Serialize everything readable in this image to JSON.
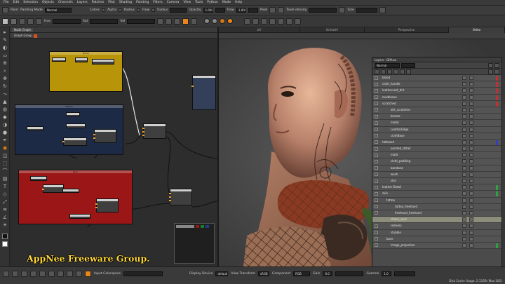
{
  "menu": [
    "File",
    "Edit",
    "Selection",
    "Objects",
    "Channels",
    "Layers",
    "Patches",
    "Pilot",
    "Shading",
    "Painting",
    "Filters",
    "Camera",
    "View",
    "Tools",
    "Python",
    "Mode",
    "Help"
  ],
  "toolbar1": {
    "paint_label": "Paint",
    "painting_mode_label": "Painting Mode",
    "painting_mode_value": "Normal",
    "colors_label": "Colors",
    "alpha_label": "Alpha",
    "radius_label": "Radius",
    "flow_label": "Flow",
    "opacity_label": "Opacity",
    "opacity_value": "1.000",
    "flow2_label": "Flow",
    "flow2_value": "1.000",
    "pixel_label": "Pixel",
    "texel_density_label": "Texel density",
    "size_label": "Size"
  },
  "toolbar2": {
    "hue_label": "Hue",
    "sat_label": "Sat",
    "val_label": "Val"
  },
  "graph": {
    "tab_label": "Node Graph",
    "group_label": "Graph Group",
    "groups": [
      {
        "name": "yellow-group",
        "title": "Bump",
        "color": "#b89409"
      },
      {
        "name": "blue-group",
        "title": "Diffuse",
        "color": "#1d2a45"
      },
      {
        "name": "red-group",
        "title": "Spec",
        "color": "#9b1717"
      }
    ]
  },
  "viewport": {
    "tabs": [
      "UV",
      "OrthoUV",
      "Perspective",
      "Ortho"
    ],
    "active_tab": "Ortho"
  },
  "layers": {
    "title": "Layers - Diffuse",
    "blend_mode": "Normal",
    "rows": [
      {
        "label": "blood",
        "indent": 0,
        "selected": false
      },
      {
        "label": "cloth_handle",
        "indent": 0,
        "selected": false
      },
      {
        "label": "leathervest_dirt",
        "indent": 0,
        "selected": false
      },
      {
        "label": "mudbrows",
        "indent": 0,
        "selected": false
      },
      {
        "label": "scratched",
        "indent": 0,
        "selected": false
      },
      {
        "label": "dirt_scratches",
        "indent": 2,
        "selected": false
      },
      {
        "label": "bronze",
        "indent": 2,
        "selected": false
      },
      {
        "label": "metal",
        "indent": 2,
        "selected": false
      },
      {
        "label": "LeatherEdge",
        "indent": 2,
        "selected": false
      },
      {
        "label": "clothBase",
        "indent": 2,
        "selected": false
      },
      {
        "label": "tattooed",
        "indent": 0,
        "selected": false
      },
      {
        "label": "painted_detail",
        "indent": 2,
        "selected": false
      },
      {
        "label": "mask",
        "indent": 2,
        "selected": false
      },
      {
        "label": "cloth_padding",
        "indent": 2,
        "selected": false
      },
      {
        "label": "bandana",
        "indent": 2,
        "selected": false
      },
      {
        "label": "wash",
        "indent": 2,
        "selected": false
      },
      {
        "label": "skin",
        "indent": 2,
        "selected": false
      },
      {
        "label": "leather Detail",
        "indent": 0,
        "selected": false
      },
      {
        "label": "skin",
        "indent": 0,
        "selected": false
      },
      {
        "label": "tattoo",
        "indent": 1,
        "selected": false
      },
      {
        "label": "tattoo_freehand",
        "indent": 3,
        "selected": false
      },
      {
        "label": "freehand_freehand",
        "indent": 3,
        "selected": false
      },
      {
        "label": "shape_spec",
        "indent": 2,
        "selected": true
      },
      {
        "label": "redness",
        "indent": 2,
        "selected": false
      },
      {
        "label": "stubble",
        "indent": 2,
        "selected": false
      },
      {
        "label": "base",
        "indent": 1,
        "selected": false
      },
      {
        "label": "image_projection",
        "indent": 2,
        "selected": false
      }
    ]
  },
  "statusbar": {
    "input_colorspace_label": "Input Colorspace",
    "display_device_label": "Display Device",
    "display_device_value": "default",
    "view_transform_label": "View Transform",
    "view_transform_value": "sRGB",
    "component_label": "Component",
    "component_value": "RGB",
    "gain_label": "Gain",
    "gain_value": "0.0",
    "gamma_label": "Gamma",
    "gamma_value": "1.0",
    "cache_info": "Disk Cache Usage: 2.13GB (Max:10G)"
  },
  "watermark": "AppNee Freeware Group."
}
